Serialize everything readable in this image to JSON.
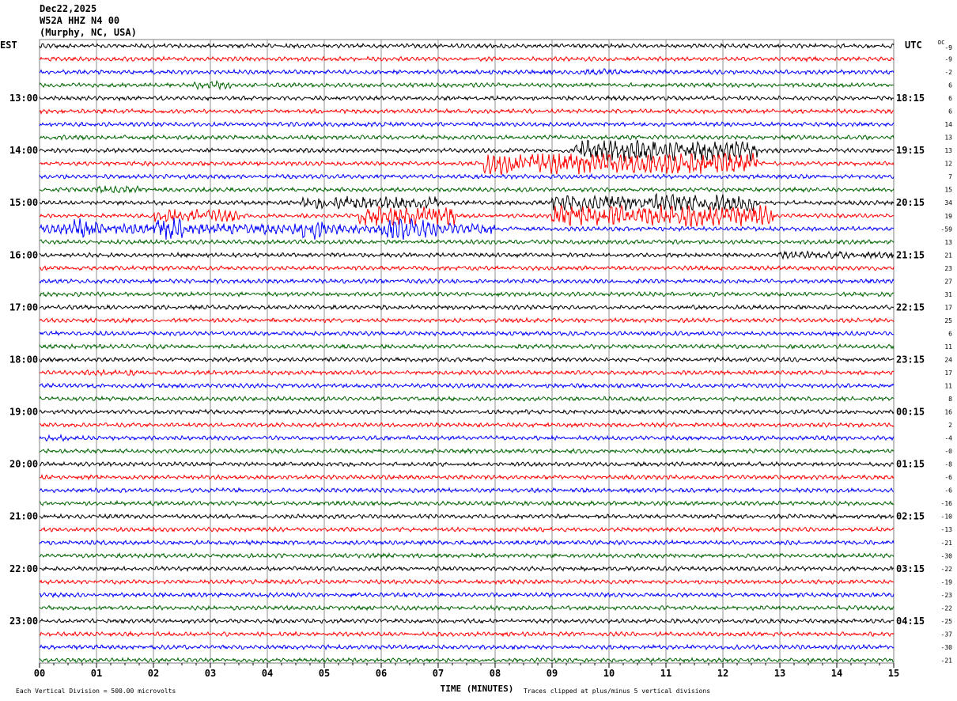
{
  "header": {
    "date": "Dec22,2025",
    "station": "W52A HHZ N4 00",
    "location": "(Murphy, NC, USA)"
  },
  "chart_data": {
    "type": "line",
    "title": "W52A HHZ N4 00 helicorder",
    "left_axis_label": "EST",
    "right_axis_label": "UTC",
    "dc_label": "DC",
    "xlabel": "TIME (MINUTES)",
    "x_ticks": [
      "00",
      "01",
      "02",
      "03",
      "04",
      "05",
      "06",
      "07",
      "08",
      "09",
      "10",
      "11",
      "12",
      "13",
      "14",
      "15"
    ],
    "xlim": [
      0,
      15
    ],
    "trace_colors": [
      "#000000",
      "#ff0000",
      "#0000ff",
      "#006400"
    ],
    "trace_count": 48,
    "left_hour_labels": [
      "13:00",
      "14:00",
      "15:00",
      "16:00",
      "17:00",
      "18:00",
      "19:00",
      "20:00",
      "21:00",
      "22:00",
      "23:00"
    ],
    "right_hour_labels": [
      "18:15",
      "19:15",
      "20:15",
      "21:15",
      "22:15",
      "23:15",
      "00:15",
      "01:15",
      "02:15",
      "03:15",
      "04:15"
    ],
    "dc_offsets": [
      "-9",
      "-9",
      "-2",
      "6",
      "6",
      "6",
      "14",
      "13",
      "13",
      "12",
      "7",
      "15",
      "34",
      "19",
      "-59",
      "13",
      "21",
      "23",
      "27",
      "31",
      "17",
      "25",
      "6",
      "11",
      "24",
      "17",
      "11",
      "8",
      "16",
      "2",
      "-4",
      "-0",
      "-8",
      "-6",
      "-6",
      "-16",
      "-10",
      "-13",
      "-21",
      "-30",
      "-22",
      "-19",
      "-23",
      "-22",
      "-25",
      "-37",
      "-30",
      "-21"
    ],
    "events": [
      {
        "trace": 2,
        "start": 9.5,
        "end": 10.2,
        "amp": 1.5
      },
      {
        "trace": 3,
        "start": 2.7,
        "end": 3.4,
        "amp": 1.8
      },
      {
        "trace": 8,
        "start": 9.4,
        "end": 12.6,
        "amp": 5
      },
      {
        "trace": 9,
        "start": 7.8,
        "end": 12.6,
        "amp": 5
      },
      {
        "trace": 11,
        "start": 1.0,
        "end": 1.8,
        "amp": 2
      },
      {
        "trace": 12,
        "start": 4.6,
        "end": 7.0,
        "amp": 3
      },
      {
        "trace": 12,
        "start": 9.0,
        "end": 12.6,
        "amp": 4
      },
      {
        "trace": 13,
        "start": 2.0,
        "end": 3.5,
        "amp": 3
      },
      {
        "trace": 13,
        "start": 5.6,
        "end": 7.3,
        "amp": 4.5
      },
      {
        "trace": 13,
        "start": 9.0,
        "end": 12.9,
        "amp": 5
      },
      {
        "trace": 14,
        "start": 0.0,
        "end": 8.0,
        "amp": 2.5
      },
      {
        "trace": 14,
        "start": 0.6,
        "end": 1.0,
        "amp": 5
      },
      {
        "trace": 14,
        "start": 2.0,
        "end": 2.5,
        "amp": 5
      },
      {
        "trace": 14,
        "start": 4.6,
        "end": 5.0,
        "amp": 5
      },
      {
        "trace": 14,
        "start": 6.0,
        "end": 7.0,
        "amp": 5
      },
      {
        "trace": 16,
        "start": 13.0,
        "end": 15.0,
        "amp": 1.8
      },
      {
        "trace": 25,
        "start": 0.8,
        "end": 1.8,
        "amp": 1.4
      },
      {
        "trace": 30,
        "start": 0.0,
        "end": 0.5,
        "amp": 1.6
      }
    ],
    "footer_scale": "Each Vertical Division =  500.00 microvolts",
    "footer_clip": "Traces clipped at plus/minus 5 vertical divisions"
  }
}
